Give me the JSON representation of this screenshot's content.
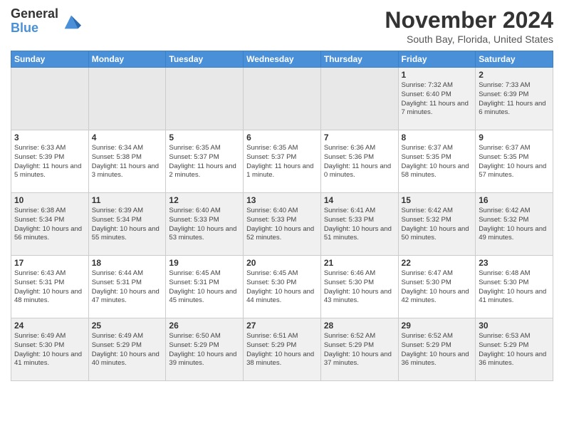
{
  "header": {
    "logo_general": "General",
    "logo_blue": "Blue",
    "month_title": "November 2024",
    "subtitle": "South Bay, Florida, United States"
  },
  "days_of_week": [
    "Sunday",
    "Monday",
    "Tuesday",
    "Wednesday",
    "Thursday",
    "Friday",
    "Saturday"
  ],
  "weeks": [
    [
      {
        "day": "",
        "info": ""
      },
      {
        "day": "",
        "info": ""
      },
      {
        "day": "",
        "info": ""
      },
      {
        "day": "",
        "info": ""
      },
      {
        "day": "",
        "info": ""
      },
      {
        "day": "1",
        "info": "Sunrise: 7:32 AM\nSunset: 6:40 PM\nDaylight: 11 hours and 7 minutes."
      },
      {
        "day": "2",
        "info": "Sunrise: 7:33 AM\nSunset: 6:39 PM\nDaylight: 11 hours and 6 minutes."
      }
    ],
    [
      {
        "day": "3",
        "info": "Sunrise: 6:33 AM\nSunset: 5:39 PM\nDaylight: 11 hours and 5 minutes."
      },
      {
        "day": "4",
        "info": "Sunrise: 6:34 AM\nSunset: 5:38 PM\nDaylight: 11 hours and 3 minutes."
      },
      {
        "day": "5",
        "info": "Sunrise: 6:35 AM\nSunset: 5:37 PM\nDaylight: 11 hours and 2 minutes."
      },
      {
        "day": "6",
        "info": "Sunrise: 6:35 AM\nSunset: 5:37 PM\nDaylight: 11 hours and 1 minute."
      },
      {
        "day": "7",
        "info": "Sunrise: 6:36 AM\nSunset: 5:36 PM\nDaylight: 11 hours and 0 minutes."
      },
      {
        "day": "8",
        "info": "Sunrise: 6:37 AM\nSunset: 5:35 PM\nDaylight: 10 hours and 58 minutes."
      },
      {
        "day": "9",
        "info": "Sunrise: 6:37 AM\nSunset: 5:35 PM\nDaylight: 10 hours and 57 minutes."
      }
    ],
    [
      {
        "day": "10",
        "info": "Sunrise: 6:38 AM\nSunset: 5:34 PM\nDaylight: 10 hours and 56 minutes."
      },
      {
        "day": "11",
        "info": "Sunrise: 6:39 AM\nSunset: 5:34 PM\nDaylight: 10 hours and 55 minutes."
      },
      {
        "day": "12",
        "info": "Sunrise: 6:40 AM\nSunset: 5:33 PM\nDaylight: 10 hours and 53 minutes."
      },
      {
        "day": "13",
        "info": "Sunrise: 6:40 AM\nSunset: 5:33 PM\nDaylight: 10 hours and 52 minutes."
      },
      {
        "day": "14",
        "info": "Sunrise: 6:41 AM\nSunset: 5:33 PM\nDaylight: 10 hours and 51 minutes."
      },
      {
        "day": "15",
        "info": "Sunrise: 6:42 AM\nSunset: 5:32 PM\nDaylight: 10 hours and 50 minutes."
      },
      {
        "day": "16",
        "info": "Sunrise: 6:42 AM\nSunset: 5:32 PM\nDaylight: 10 hours and 49 minutes."
      }
    ],
    [
      {
        "day": "17",
        "info": "Sunrise: 6:43 AM\nSunset: 5:31 PM\nDaylight: 10 hours and 48 minutes."
      },
      {
        "day": "18",
        "info": "Sunrise: 6:44 AM\nSunset: 5:31 PM\nDaylight: 10 hours and 47 minutes."
      },
      {
        "day": "19",
        "info": "Sunrise: 6:45 AM\nSunset: 5:31 PM\nDaylight: 10 hours and 45 minutes."
      },
      {
        "day": "20",
        "info": "Sunrise: 6:45 AM\nSunset: 5:30 PM\nDaylight: 10 hours and 44 minutes."
      },
      {
        "day": "21",
        "info": "Sunrise: 6:46 AM\nSunset: 5:30 PM\nDaylight: 10 hours and 43 minutes."
      },
      {
        "day": "22",
        "info": "Sunrise: 6:47 AM\nSunset: 5:30 PM\nDaylight: 10 hours and 42 minutes."
      },
      {
        "day": "23",
        "info": "Sunrise: 6:48 AM\nSunset: 5:30 PM\nDaylight: 10 hours and 41 minutes."
      }
    ],
    [
      {
        "day": "24",
        "info": "Sunrise: 6:49 AM\nSunset: 5:30 PM\nDaylight: 10 hours and 41 minutes."
      },
      {
        "day": "25",
        "info": "Sunrise: 6:49 AM\nSunset: 5:29 PM\nDaylight: 10 hours and 40 minutes."
      },
      {
        "day": "26",
        "info": "Sunrise: 6:50 AM\nSunset: 5:29 PM\nDaylight: 10 hours and 39 minutes."
      },
      {
        "day": "27",
        "info": "Sunrise: 6:51 AM\nSunset: 5:29 PM\nDaylight: 10 hours and 38 minutes."
      },
      {
        "day": "28",
        "info": "Sunrise: 6:52 AM\nSunset: 5:29 PM\nDaylight: 10 hours and 37 minutes."
      },
      {
        "day": "29",
        "info": "Sunrise: 6:52 AM\nSunset: 5:29 PM\nDaylight: 10 hours and 36 minutes."
      },
      {
        "day": "30",
        "info": "Sunrise: 6:53 AM\nSunset: 5:29 PM\nDaylight: 10 hours and 36 minutes."
      }
    ]
  ]
}
